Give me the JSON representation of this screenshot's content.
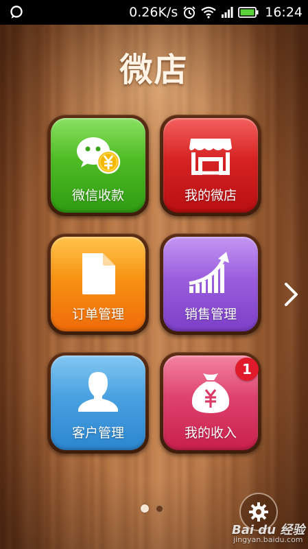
{
  "status_bar": {
    "speed": "0.26K/s",
    "time": "16:24",
    "icons": [
      "chat-bubble-icon",
      "alarm-icon",
      "wifi-icon",
      "signal-icon",
      "battery-icon"
    ]
  },
  "app": {
    "title": "微店"
  },
  "tiles": [
    {
      "label": "微信收款",
      "icon": "wechat-payment-icon",
      "color": "#3faa1e"
    },
    {
      "label": "我的微店",
      "icon": "storefront-icon",
      "color": "#d81e20"
    },
    {
      "label": "订单管理",
      "icon": "document-icon",
      "color": "#f78a10"
    },
    {
      "label": "销售管理",
      "icon": "sales-growth-icon",
      "color": "#9a58dd"
    },
    {
      "label": "客户管理",
      "icon": "person-icon",
      "color": "#3d9be0"
    },
    {
      "label": "我的收入",
      "icon": "money-bag-icon",
      "color": "#dc3a66",
      "badge": "1"
    }
  ],
  "pager": {
    "pages": 2,
    "current": 1
  },
  "watermark": {
    "brand": "Bai du 经验",
    "url": "jingyan.baidu.com"
  }
}
